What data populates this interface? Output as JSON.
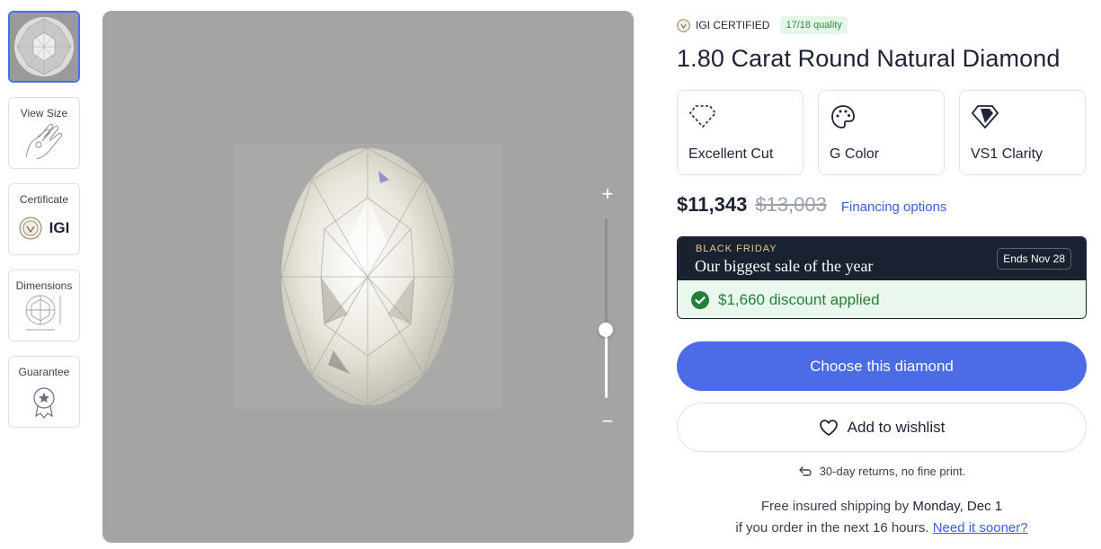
{
  "thumbnails": [
    {
      "label": "",
      "icon": "diamond-photo"
    },
    {
      "label": "View Size",
      "icon": "hand-ring-icon"
    },
    {
      "label": "Certificate",
      "icon": "igi-seal-icon",
      "brand": "IGI"
    },
    {
      "label": "Dimensions",
      "icon": "dimensions-icon"
    },
    {
      "label": "Guarantee",
      "icon": "guarantee-badge-icon"
    }
  ],
  "viewer": {
    "zoom_in": "+",
    "zoom_out": "−",
    "zoom_level_fraction": 0.38
  },
  "product": {
    "cert_label": "IGI CERTIFIED",
    "quality_badge": "17/18 quality",
    "title": "1.80 Carat Round Natural Diamond",
    "specs": [
      {
        "label": "Excellent Cut",
        "icon": "cut-outline-icon"
      },
      {
        "label": "G Color",
        "icon": "palette-icon"
      },
      {
        "label": "VS1 Clarity",
        "icon": "diamond-clarity-icon"
      }
    ],
    "price": "$11,343",
    "old_price": "$13,003",
    "financing": "Financing options"
  },
  "promo": {
    "kicker": "BLACK FRIDAY",
    "headline": "Our biggest sale of the year",
    "ends": "Ends Nov 28",
    "discount": "$1,660 discount applied"
  },
  "actions": {
    "choose": "Choose this diamond",
    "wishlist": "Add to wishlist"
  },
  "shipping": {
    "returns": "30-day returns, no fine print.",
    "line1_prefix": "Free insured shipping by ",
    "line1_date": "Monday, Dec 1",
    "line2_prefix": "if you order in the next 16 hours. ",
    "sooner_link": "Need it sooner?"
  },
  "colors": {
    "accent_blue": "#4b6be7",
    "promo_dark": "#1a2131",
    "success_green": "#23803b",
    "viewer_bg": "#a4a4a2"
  }
}
